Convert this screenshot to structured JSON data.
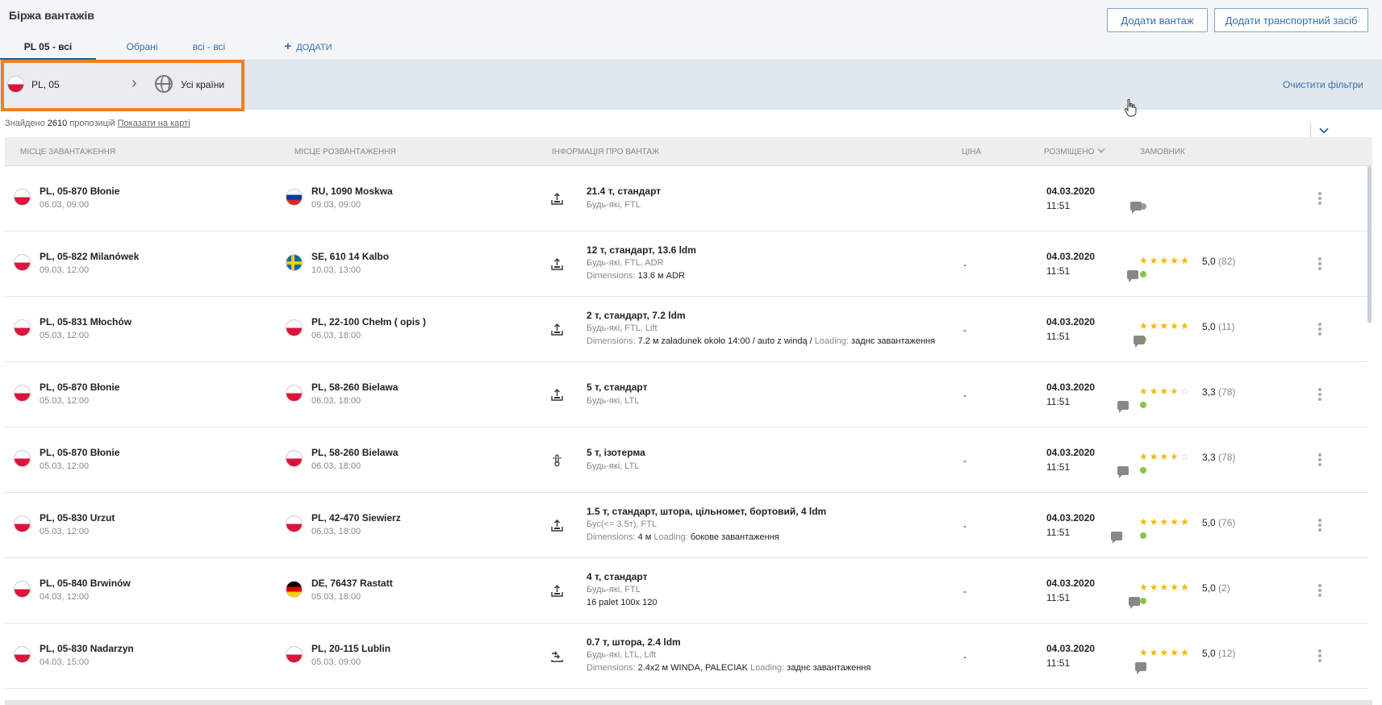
{
  "header": {
    "title": "Біржа вантажів",
    "add_cargo": "Додати вантаж",
    "add_vehicle": "Додати транспортний засіб"
  },
  "tabs": {
    "all": "PL 05 - всі",
    "favorites": "Обрані",
    "all2": "всі - всі",
    "add": "ДОДАТИ"
  },
  "filter": {
    "from": "PL, 05",
    "to": "Усі країни",
    "clear": "Очистити фільтри"
  },
  "results": {
    "prefix": "Знайдено",
    "count": "2610",
    "suffix": "пропозицій",
    "map_link": "Показати на карті"
  },
  "columns": {
    "load": "МІСЦЕ ЗАВАНТАЖЕННЯ",
    "unload": "МІСЦЕ РОЗВАНТАЖЕННЯ",
    "info": "ІНФОРМАЦІЯ ПРО ВАНТАЖ",
    "price": "ЦІНА",
    "placed": "РОЗМІЩЕНО",
    "customer": "ЗАМОВНИК"
  },
  "rows": [
    {
      "load_flag": "pl",
      "load": "PL, 05-870 Błonie",
      "load_date": "06.03, 09:00",
      "unload_flag": "ru",
      "unload": "RU, 1090 Moskwa",
      "unload_date": "09.03, 09:00",
      "title": "21.4 т, стандарт",
      "sub": "Будь-які, FTL",
      "price": "",
      "placed_date": "04.03.2020",
      "placed_time": "11:51",
      "rating": "",
      "rating_count": "",
      "stars": 0,
      "status": "gray"
    },
    {
      "load_flag": "pl",
      "load": "PL, 05-822 Milanówek",
      "load_date": "09.03, 12:00",
      "unload_flag": "se",
      "unload": "SE, 610 14 Kalbo",
      "unload_date": "10.03, 13:00",
      "title": "12 т, стандарт, 13.6 ldm",
      "sub": "Будь-які, FTL, ADR",
      "detail_label": "Dimensions:",
      "detail": "13.6 м ADR",
      "price": "-",
      "placed_date": "04.03.2020",
      "placed_time": "11:51",
      "rating": "5,0",
      "rating_count": "(82)",
      "stars": 5,
      "status": "green"
    },
    {
      "load_flag": "pl",
      "load": "PL, 05-831 Młochów",
      "load_date": "05.03, 12:00",
      "unload_flag": "pl",
      "unload": "PL, 22-100 Chełm ( opis )",
      "unload_date": "06.03, 18:00",
      "title": "2 т, стандарт, 7.2 ldm",
      "sub": "Будь-які, FTL, Lift",
      "detail_label": "Dimensions:",
      "detail": "7.2 м załadunek około 14:00 / auto z windą /",
      "detail_label2": "Loading:",
      "detail2": "заднє завантаження",
      "price": "-",
      "placed_date": "04.03.2020",
      "placed_time": "11:51",
      "rating": "5,0",
      "rating_count": "(11)",
      "stars": 5,
      "status": "green"
    },
    {
      "load_flag": "pl",
      "load": "PL, 05-870 Błonie",
      "load_date": "05.03, 12:00",
      "unload_flag": "pl",
      "unload": "PL, 58-260 Bielawa",
      "unload_date": "06.03, 18:00",
      "title": "5 т, стандарт",
      "sub": "Будь-які, LTL",
      "price": "-",
      "placed_date": "04.03.2020",
      "placed_time": "11:51",
      "rating": "3,3",
      "rating_count": "(78)",
      "stars": 3.5,
      "status": "green"
    },
    {
      "load_flag": "pl",
      "load": "PL, 05-870 Błonie",
      "load_date": "05.03, 12:00",
      "unload_flag": "pl",
      "unload": "PL, 58-260 Bielawa",
      "unload_date": "06.03, 18:00",
      "title": "5 т, ізотерма",
      "sub": "Будь-які, LTL",
      "price": "-",
      "placed_date": "04.03.2020",
      "placed_time": "11:51",
      "rating": "3,3",
      "rating_count": "(78)",
      "stars": 3.5,
      "status": "green"
    },
    {
      "load_flag": "pl",
      "load": "PL, 05-830 Urzut",
      "load_date": "05.03, 12:00",
      "unload_flag": "pl",
      "unload": "PL, 42-470 Siewierz",
      "unload_date": "06.03, 18:00",
      "title": "1.5 т, стандарт, штора, цільномет, бортовий, 4 ldm",
      "sub": "Бус(<= 3.5т), FTL",
      "detail_label": "Dimensions:",
      "detail": "4 м",
      "detail_label2": "Loading:",
      "detail2": "бокове завантаження",
      "price": "-",
      "placed_date": "04.03.2020",
      "placed_time": "11:51",
      "rating": "5,0",
      "rating_count": "(76)",
      "stars": 5,
      "status": "green"
    },
    {
      "load_flag": "pl",
      "load": "PL, 05-840 Brwinów",
      "load_date": "04.03, 12:00",
      "unload_flag": "de",
      "unload": "DE, 76437 Rastatt",
      "unload_date": "05.03, 18:00",
      "title": "4 т, стандарт",
      "sub": "Будь-які, FTL",
      "detail": "16 palet 100x 120",
      "price": "-",
      "placed_date": "04.03.2020",
      "placed_time": "11:51",
      "rating": "5,0",
      "rating_count": "(2)",
      "stars": 5,
      "status": "green"
    },
    {
      "load_flag": "pl",
      "load": "PL, 05-830 Nadarzyn",
      "load_date": "04.03, 15:00",
      "unload_flag": "pl",
      "unload": "PL, 20-115 Lublin",
      "unload_date": "05.03, 09:00",
      "title": "0.7 т, штора, 2.4 ldm",
      "sub": "Будь-які, LTL, Lift",
      "detail_label": "Dimensions:",
      "detail": "2.4x2 м WINDA, PALECIAK",
      "detail_label2": "Loading:",
      "detail2": "заднє завантаження",
      "price": "-",
      "placed_date": "04.03.2020",
      "placed_time": "11:51",
      "rating": "5,0",
      "rating_count": "(12)",
      "stars": 5,
      "status": "gray"
    }
  ]
}
